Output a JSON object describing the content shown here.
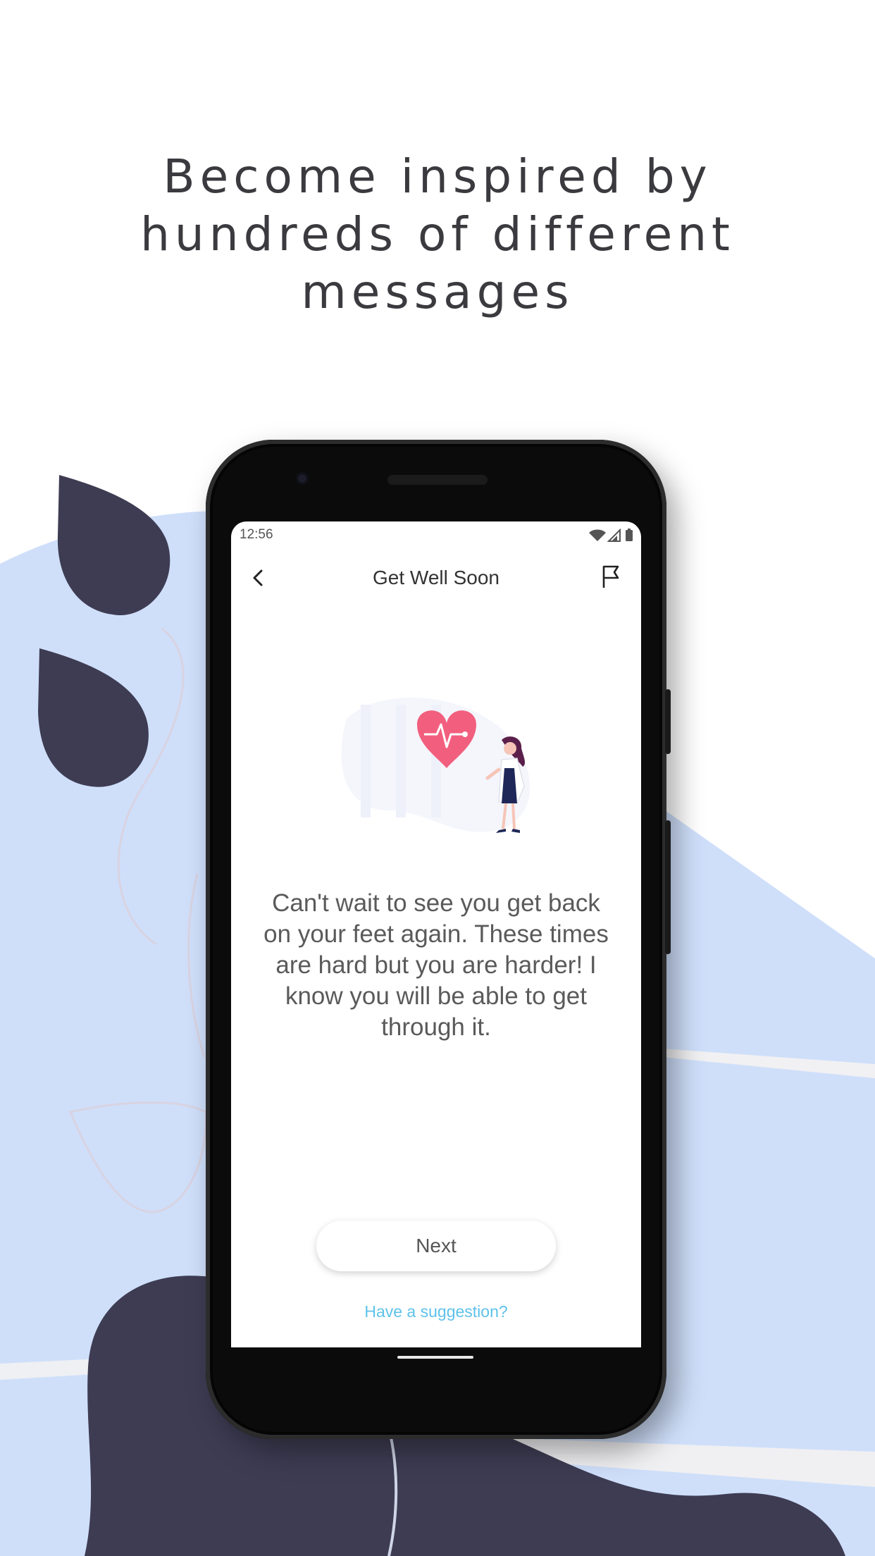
{
  "headline": {
    "line1": "Become inspired by",
    "line2": "hundreds of different",
    "line3": "messages"
  },
  "colors": {
    "background_light_blue": "#cfdffa",
    "dark_navy": "#3e3c53",
    "accent_pink": "#f25f7e",
    "link_blue": "#5ec2ea"
  },
  "phone": {
    "status_bar": {
      "time": "12:56",
      "icons": [
        "wifi-icon",
        "signal-icon",
        "battery-icon"
      ]
    },
    "app_bar": {
      "title": "Get Well Soon",
      "back_icon": "chevron-left-icon",
      "report_icon": "flag-icon"
    },
    "illustration": "doctor-with-heart-illustration",
    "message": "Can't wait to see you get back on your feet again. These times are hard but you are harder! I know you will be able to get through it.",
    "next_label": "Next",
    "suggestion_link": "Have a suggestion?"
  }
}
